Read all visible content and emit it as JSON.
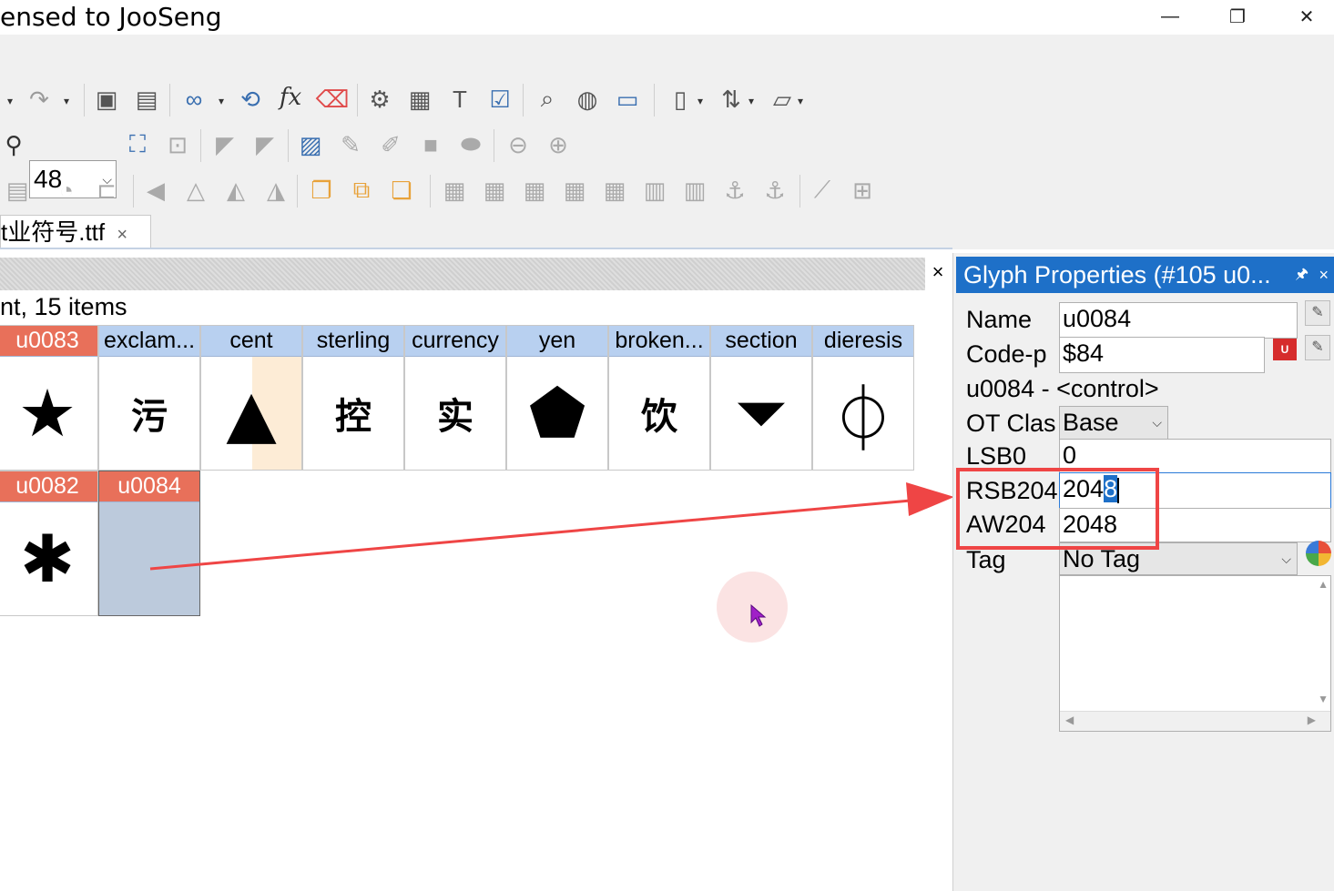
{
  "window": {
    "title": "ensed to JooSeng",
    "min_label": "—",
    "max_label": "❐",
    "close_label": "✕"
  },
  "toolbar": {
    "zoom_value": "48",
    "zoom_caret": "⌵"
  },
  "document_tab": {
    "label": "t业符号.ttf",
    "close": "×"
  },
  "glyph_panel": {
    "close": "×",
    "font_info": "nt, 15 items",
    "row1": [
      {
        "name": "u0083",
        "glyph": "★",
        "kind": "sym",
        "highlight": true
      },
      {
        "name": "exclam...",
        "glyph": "污",
        "kind": "han",
        "highlight": false
      },
      {
        "name": "cent",
        "glyph": "▲",
        "kind": "sym",
        "highlight": false
      },
      {
        "name": "sterling",
        "glyph": "控",
        "kind": "han",
        "highlight": false
      },
      {
        "name": "currency",
        "glyph": "实",
        "kind": "han",
        "highlight": false
      },
      {
        "name": "yen",
        "glyph": "⬟",
        "kind": "sym",
        "highlight": false
      },
      {
        "name": "broken...",
        "glyph": "饮",
        "kind": "han",
        "highlight": false
      },
      {
        "name": "section",
        "glyph": "⏷",
        "kind": "sym",
        "highlight": false
      },
      {
        "name": "dieresis",
        "glyph": "⏀",
        "kind": "sym",
        "highlight": false
      }
    ],
    "row2": [
      {
        "name": "u0082",
        "glyph": "✱",
        "kind": "sym",
        "highlight": true
      },
      {
        "name": "u0084",
        "glyph": "",
        "kind": "sym",
        "highlight": true
      }
    ]
  },
  "properties": {
    "title": "Glyph Properties (#105 u0...",
    "pin": "🖈",
    "close": "×",
    "name_label": "Name",
    "name_value": "u0084",
    "codepoint_label": "Code-p",
    "codepoint_value": "$84",
    "unicode_desc": "u0084 - <control>",
    "otclass_label": "OT Clas",
    "otclass_value": "Base",
    "lsb_label": "LSB0",
    "lsb_value": "0",
    "rsb_label": "RSB204",
    "rsb_value_plain": "204",
    "rsb_value_selected": "8",
    "aw_label": "AW204",
    "aw_value": "2048",
    "tag_label": "Tag",
    "tag_value": "No Tag"
  },
  "colors": {
    "accent": "#1e70c8",
    "highlight": "#ef4545",
    "header_blue": "#b8d0f0",
    "header_red": "#e8705a"
  }
}
